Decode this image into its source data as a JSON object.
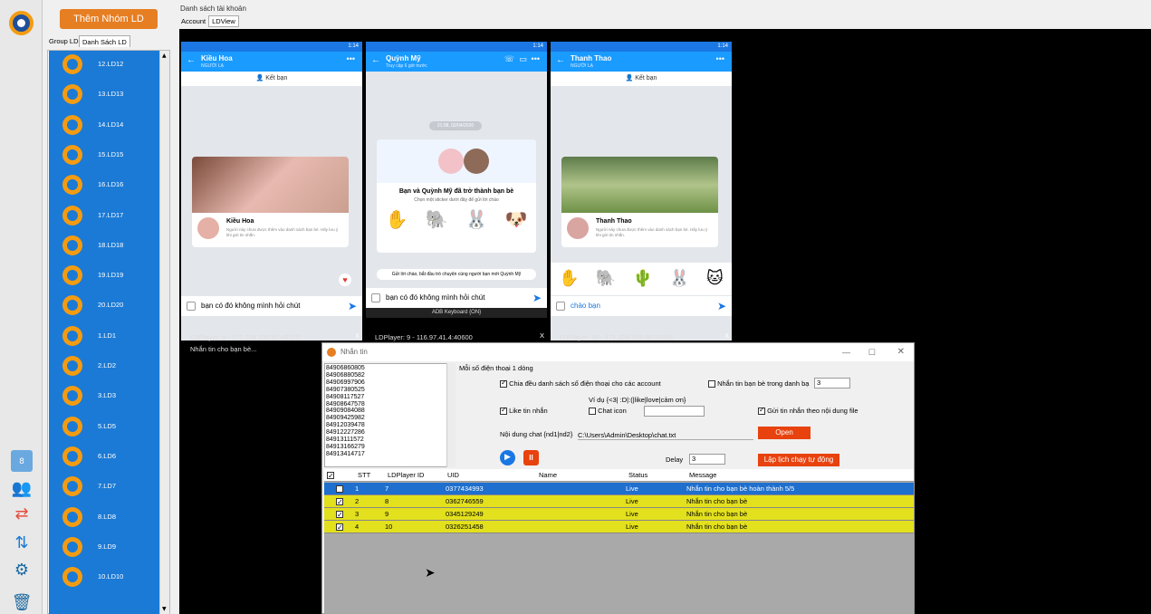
{
  "sidebar_left": {
    "icons": [
      "calendar-icon",
      "users-icon",
      "sync-icon",
      "transfer-icon",
      "gear-icon",
      "trash-icon"
    ],
    "calendar_day": "8"
  },
  "add_group_button": "Thêm Nhóm LD",
  "tabs": [
    "Group LD",
    "Danh Sách LD"
  ],
  "ld_list": [
    "12.LD12",
    "13.LD13",
    "14.LD14",
    "15.LD15",
    "16.LD16",
    "17.LD17",
    "18.LD18",
    "19.LD19",
    "20.LD20",
    "1.LD1",
    "2.LD2",
    "3.LD3",
    "5.LD5",
    "6.LD6",
    "7.LD7",
    "8.LD8",
    "9.LD9",
    "10.LD10"
  ],
  "section_title": "Danh sách tài khoản",
  "view_tabs": [
    "Account",
    "LDView"
  ],
  "phones": [
    {
      "time": "1:14",
      "contact": "Kiều Hoa",
      "badge": "NGƯỜI LẠ",
      "friend_btn": "Kết bạn",
      "card_name": "Kiều Hoa",
      "card_text": "Người này chưa được thêm vào danh sách bạn bè. Hãy lưu ý khi gửi tin nhắn.",
      "message": "bạn có đó không mình hỏi chút",
      "label": "LDPlayer: 8 - 171.234.235.52:46375",
      "close": "X",
      "status": "Nhắn tin cho bạn bè..."
    },
    {
      "time": "1:14",
      "contact": "Quỳnh Mỹ",
      "subtitle": "Truy cập 6 giờ trước",
      "date_chip": "21:08, 02/04/2020",
      "friend_title": "Bạn và Quỳnh Mỹ đã trở thành bạn bè",
      "friend_sub": "Chọn một sticker dưới đây để gửi lời chào",
      "tip": "Gửi lời chào, bắt đầu trò chuyện cùng người bạn mới Quỳnh Mỹ",
      "message": "bạn có đó không mình hỏi chút",
      "keyboard": "ADB Keyboard {ON}",
      "label": "LDPlayer: 9 - 116.97.41.4:40600",
      "close": "X"
    },
    {
      "time": "1:14",
      "contact": "Thanh Thao",
      "badge": "NGƯỜI LẠ",
      "friend_btn": "Kết bạn",
      "card_name": "Thanh Thao",
      "card_text": "Người này chưa được thêm vào danh sách bạn bè. Hãy lưu ý khi gửi tin nhắn.",
      "message": "chào bạn",
      "label": "LDPlayer: 10 - 171.224.225.80:15036",
      "close": "X"
    }
  ],
  "dialog": {
    "title": "Nhắn tin",
    "phones": [
      "84906860805",
      "84906880582",
      "84906997906",
      "84907380525",
      "84908117527",
      "84908647578",
      "84909084088",
      "84909425982",
      "84912039478",
      "84912227286",
      "84913111572",
      "84913166279",
      "84913414717"
    ],
    "one_per_line": "Mỗi số điện thoại 1 dòng",
    "split_label": "Chia đều danh sách số điện thoại cho các account",
    "friend_contacts_label": "Nhắn tin bạn bè trong danh bạ",
    "friend_contacts_value": "3",
    "example": "Ví dụ {<3| :D|:(|like|love|cảm ơn}",
    "like_label": "Like tin nhắn",
    "chat_icon_label": "Chat icon",
    "chat_icon_value": "",
    "file_send_label": "Gửi tin nhắn theo nội dung file",
    "content_label": "Nội dung chat {nd1|nd2}",
    "file_path": "C:\\Users\\Admin\\Desktop\\chat.txt",
    "open_btn": "Open",
    "delay_label": "Delay",
    "delay_value": "3",
    "schedule_btn": "Lập lịch chạy tự động",
    "columns": [
      "STT",
      "LDPlayer ID",
      "UID",
      "Name",
      "Status",
      "Message"
    ],
    "rows": [
      {
        "stt": "1",
        "ld": "7",
        "uid": "0377434993",
        "name": "",
        "status": "Live",
        "message": "Nhắn tin cho bạn bè hoàn thành 5/5",
        "selected": true
      },
      {
        "stt": "2",
        "ld": "8",
        "uid": "0362746559",
        "name": "",
        "status": "Live",
        "message": "Nhắn tin cho bạn bè",
        "selected": false
      },
      {
        "stt": "3",
        "ld": "9",
        "uid": "0345129249",
        "name": "",
        "status": "Live",
        "message": "Nhắn tin cho bạn bè",
        "selected": false
      },
      {
        "stt": "4",
        "ld": "10",
        "uid": "0326251458",
        "name": "",
        "status": "Live",
        "message": "Nhắn tin cho bạn bè",
        "selected": false
      }
    ]
  },
  "colors": {
    "list_blue": "#1b7ad6",
    "selected_row": "#1e6fce",
    "yellow_row": "#e3e01d",
    "accent_orange": "#e67e22"
  }
}
